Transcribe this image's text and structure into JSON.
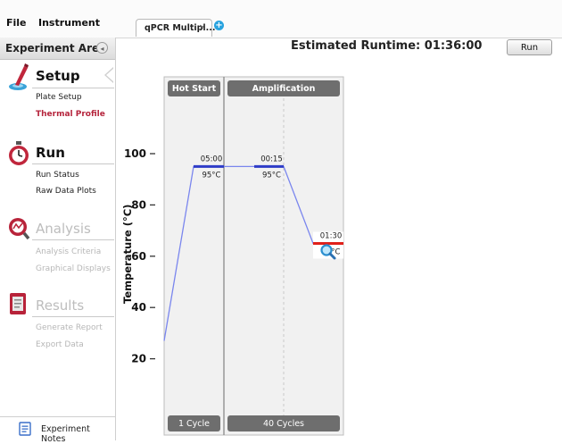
{
  "menu": {
    "file": "File",
    "instrument": "Instrument"
  },
  "tab": {
    "label": "qPCR Multipl...",
    "close": "×",
    "add": "+"
  },
  "sidebar": {
    "title": "Experiment Area",
    "collapse": "◂",
    "sections": [
      {
        "title": "Setup",
        "icon": "setup-icon",
        "enabled": true,
        "items": [
          {
            "label": "Plate Setup",
            "state": "normal"
          },
          {
            "label": "Thermal Profile",
            "state": "active"
          }
        ]
      },
      {
        "title": "Run",
        "icon": "stopwatch-icon",
        "enabled": true,
        "items": [
          {
            "label": "Run Status",
            "state": "normal"
          },
          {
            "label": "Raw Data Plots",
            "state": "normal"
          }
        ]
      },
      {
        "title": "Analysis",
        "icon": "analysis-icon",
        "enabled": false,
        "items": [
          {
            "label": "Analysis Criteria",
            "state": "disabled"
          },
          {
            "label": "Graphical Displays",
            "state": "disabled"
          }
        ]
      },
      {
        "title": "Results",
        "icon": "results-icon",
        "enabled": false,
        "items": [
          {
            "label": "Generate Report",
            "state": "disabled"
          },
          {
            "label": "Export Data",
            "state": "disabled"
          }
        ]
      }
    ],
    "notes": "Experiment Notes"
  },
  "header": {
    "runtime": "Estimated Runtime:  01:36:00",
    "run_button": "Run"
  },
  "profile": {
    "y_label": "Temperature (°C)",
    "y_ticks": [
      100,
      80,
      60,
      40,
      20
    ],
    "y_range": [
      0,
      110
    ],
    "start_temp": 27,
    "stages": [
      {
        "name": "Hot Start",
        "cycles": "1 Cycle"
      },
      {
        "name": "Amplification",
        "cycles": "40 Cycles"
      }
    ],
    "steps": [
      {
        "time": "05:00",
        "temp_label": "95°C",
        "temp": 95,
        "stage": 0
      },
      {
        "time": "00:15",
        "temp_label": "95°C",
        "temp": 95,
        "stage": 1
      },
      {
        "time": "01:30",
        "temp_label": "65°C",
        "temp": 65,
        "stage": 1,
        "selected": true
      }
    ],
    "colors": {
      "step": "#2e3cc7",
      "selected": "#e0201a",
      "ramp": "#7a86ee",
      "stage_header": "#6e6e6e"
    },
    "zoom_icon": "magnifier-icon"
  }
}
